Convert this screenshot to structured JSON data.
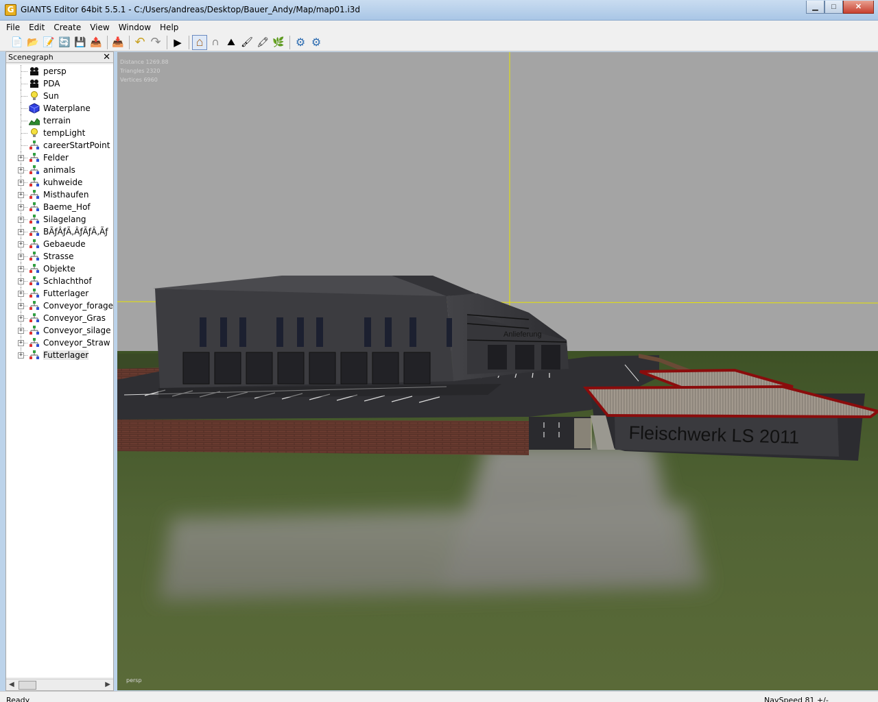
{
  "window": {
    "title": "GIANTS Editor 64bit 5.5.1 - C:/Users/andreas/Desktop/Bauer_Andy/Map/map01.i3d",
    "icon_letter": "G",
    "minimize": "▁",
    "maximize": "□",
    "close": "✕"
  },
  "menu": [
    "File",
    "Edit",
    "Create",
    "View",
    "Window",
    "Help"
  ],
  "toolbar": {
    "buttons": [
      {
        "icon": "new-file-icon",
        "glyph": "📄"
      },
      {
        "icon": "open-folder-icon",
        "glyph": "📂"
      },
      {
        "icon": "edit-icon",
        "glyph": "📝"
      },
      {
        "icon": "refresh-icon",
        "glyph": "🔄"
      },
      {
        "icon": "save-icon",
        "glyph": "💾"
      },
      {
        "icon": "export-icon",
        "glyph": "📤"
      },
      {
        "icon": "import-icon",
        "glyph": "📥"
      },
      {
        "icon": "undo-icon",
        "glyph": "↶"
      },
      {
        "icon": "redo-icon",
        "glyph": "↷"
      },
      {
        "icon": "play-icon",
        "glyph": "▶"
      },
      {
        "icon": "home-icon",
        "glyph": "⌂",
        "active": true
      },
      {
        "icon": "magnet-icon",
        "glyph": "∩"
      },
      {
        "icon": "terrain-sculpt-icon",
        "glyph": "⛰"
      },
      {
        "icon": "terrain-paint-icon",
        "glyph": "🖌"
      },
      {
        "icon": "terrain-smooth-icon",
        "glyph": "🖍"
      },
      {
        "icon": "foliage-paint-icon",
        "glyph": "🌿"
      },
      {
        "icon": "settings-icon",
        "glyph": "⚙"
      },
      {
        "icon": "options-icon",
        "glyph": "⚙"
      }
    ]
  },
  "scenegraph": {
    "title": "Scenegraph",
    "close": "✕",
    "items": [
      {
        "label": "persp",
        "icon": "camera-icon",
        "expandable": false
      },
      {
        "label": "PDA",
        "icon": "camera-icon",
        "expandable": false
      },
      {
        "label": "Sun",
        "icon": "light-bulb-icon",
        "expandable": false
      },
      {
        "label": "Waterplane",
        "icon": "cube-icon",
        "expandable": false
      },
      {
        "label": "terrain",
        "icon": "terrain-icon",
        "expandable": false
      },
      {
        "label": "tempLight",
        "icon": "light-bulb-icon",
        "expandable": false
      },
      {
        "label": "careerStartPoint",
        "icon": "transform-group-icon",
        "expandable": false
      },
      {
        "label": "Felder",
        "icon": "transform-group-icon",
        "expandable": true
      },
      {
        "label": "animals",
        "icon": "transform-group-icon",
        "expandable": true
      },
      {
        "label": "kuhweide",
        "icon": "transform-group-icon",
        "expandable": true
      },
      {
        "label": "Misthaufen",
        "icon": "transform-group-icon",
        "expandable": true
      },
      {
        "label": "Baeme_Hof",
        "icon": "transform-group-icon",
        "expandable": true
      },
      {
        "label": "Silagelang",
        "icon": "transform-group-icon",
        "expandable": true
      },
      {
        "label": "BÃƒÂƒÃ‚ÂƒÃƒÂ‚Ãƒ",
        "icon": "transform-group-icon",
        "expandable": true
      },
      {
        "label": "Gebaeude",
        "icon": "transform-group-icon",
        "expandable": true
      },
      {
        "label": "Strasse",
        "icon": "transform-group-icon",
        "expandable": true
      },
      {
        "label": "Objekte",
        "icon": "transform-group-icon",
        "expandable": true
      },
      {
        "label": "Schlachthof",
        "icon": "transform-group-icon",
        "expandable": true
      },
      {
        "label": "Futterlager",
        "icon": "transform-group-icon",
        "expandable": true
      },
      {
        "label": "Conveyor_forage",
        "icon": "transform-group-icon",
        "expandable": true
      },
      {
        "label": "Conveyor_Gras",
        "icon": "transform-group-icon",
        "expandable": true
      },
      {
        "label": "Conveyor_silage",
        "icon": "transform-group-icon",
        "expandable": true
      },
      {
        "label": "Conveyor_Straw",
        "icon": "transform-group-icon",
        "expandable": true
      },
      {
        "label": "Futterlager",
        "icon": "transform-group-icon",
        "expandable": true,
        "selected": true
      }
    ],
    "scroll_left": "◀",
    "scroll_right": "▶"
  },
  "viewport": {
    "stats": [
      "Distance 1269.88",
      "Triangles 2320",
      "Vertices 6960"
    ],
    "camera": "persp",
    "sign_text": "Fleischwerk LS 2011",
    "building_label": "Anlieferung"
  },
  "statusbar": {
    "left": "Ready",
    "right": "NavSpeed 81 +/-"
  },
  "colors": {
    "sky": "#a4a4a4",
    "grass": "#4e5e32",
    "asphalt": "#2f2f33",
    "building": "#3c3c40",
    "axis_yellow": "#e8e400",
    "roof_red": "#8a0c0c"
  }
}
